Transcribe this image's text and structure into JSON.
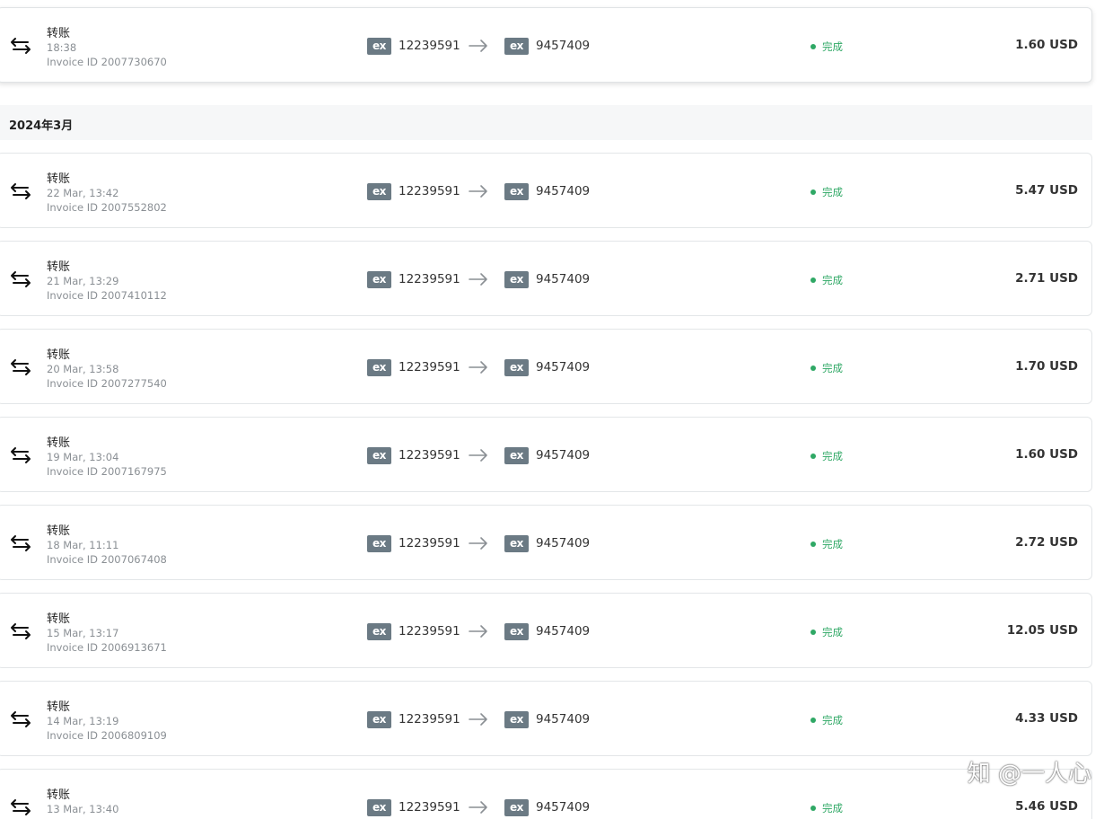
{
  "month_header": "2024年3月",
  "transactions": [
    {
      "title": "转账",
      "time": "18:38",
      "invoice": "Invoice ID 2007730670",
      "from_badge": "ex",
      "from_account": "12239591",
      "to_badge": "ex",
      "to_account": "9457409",
      "status": "完成",
      "amount": "1.60 USD"
    },
    {
      "title": "转账",
      "time": "22 Mar, 13:42",
      "invoice": "Invoice ID 2007552802",
      "from_badge": "ex",
      "from_account": "12239591",
      "to_badge": "ex",
      "to_account": "9457409",
      "status": "完成",
      "amount": "5.47 USD"
    },
    {
      "title": "转账",
      "time": "21 Mar, 13:29",
      "invoice": "Invoice ID 2007410112",
      "from_badge": "ex",
      "from_account": "12239591",
      "to_badge": "ex",
      "to_account": "9457409",
      "status": "完成",
      "amount": "2.71 USD"
    },
    {
      "title": "转账",
      "time": "20 Mar, 13:58",
      "invoice": "Invoice ID 2007277540",
      "from_badge": "ex",
      "from_account": "12239591",
      "to_badge": "ex",
      "to_account": "9457409",
      "status": "完成",
      "amount": "1.70 USD"
    },
    {
      "title": "转账",
      "time": "19 Mar, 13:04",
      "invoice": "Invoice ID 2007167975",
      "from_badge": "ex",
      "from_account": "12239591",
      "to_badge": "ex",
      "to_account": "9457409",
      "status": "完成",
      "amount": "1.60 USD"
    },
    {
      "title": "转账",
      "time": "18 Mar, 11:11",
      "invoice": "Invoice ID 2007067408",
      "from_badge": "ex",
      "from_account": "12239591",
      "to_badge": "ex",
      "to_account": "9457409",
      "status": "完成",
      "amount": "2.72 USD"
    },
    {
      "title": "转账",
      "time": "15 Mar, 13:17",
      "invoice": "Invoice ID 2006913671",
      "from_badge": "ex",
      "from_account": "12239591",
      "to_badge": "ex",
      "to_account": "9457409",
      "status": "完成",
      "amount": "12.05 USD"
    },
    {
      "title": "转账",
      "time": "14 Mar, 13:19",
      "invoice": "Invoice ID 2006809109",
      "from_badge": "ex",
      "from_account": "12239591",
      "to_badge": "ex",
      "to_account": "9457409",
      "status": "完成",
      "amount": "4.33 USD"
    },
    {
      "title": "转账",
      "time": "13 Mar, 13:40",
      "invoice": "",
      "from_badge": "ex",
      "from_account": "12239591",
      "to_badge": "ex",
      "to_account": "9457409",
      "status": "完成",
      "amount": "5.46 USD"
    }
  ],
  "watermark": "知 @一人心",
  "colors": {
    "status_green": "#2fa865",
    "badge_gray": "#6b7a84",
    "month_header_bg": "#f6f7f8"
  },
  "icons": {
    "transaction": "transfer-arrows-icon",
    "direction": "arrow-right-icon",
    "status": "status-dot-icon"
  }
}
